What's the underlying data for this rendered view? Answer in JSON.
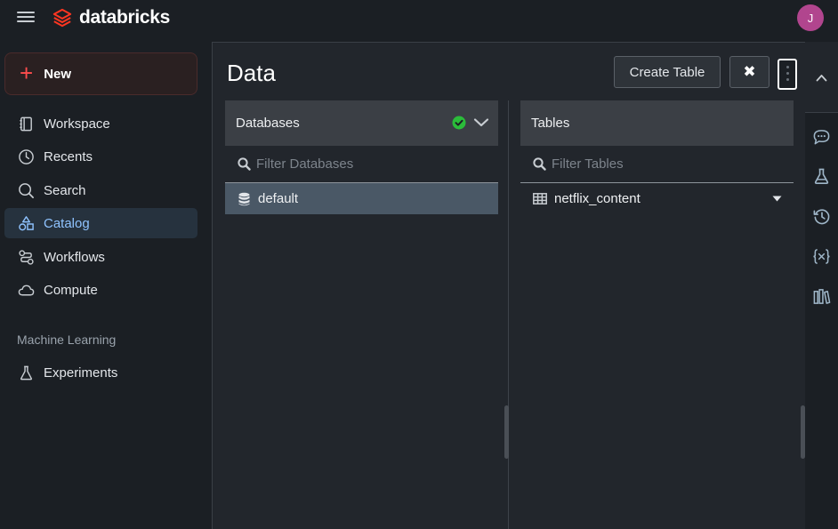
{
  "app": {
    "brand": "databricks",
    "avatar_initial": "J",
    "brand_color": "#ff3621",
    "accent_color": "#8fc3ff"
  },
  "sidebar": {
    "new_label": "New",
    "items": [
      {
        "label": "Workspace",
        "icon": "notebook-icon"
      },
      {
        "label": "Recents",
        "icon": "clock-icon"
      },
      {
        "label": "Search",
        "icon": "search-icon"
      },
      {
        "label": "Catalog",
        "icon": "catalog-icon",
        "active": true
      },
      {
        "label": "Workflows",
        "icon": "workflows-icon"
      },
      {
        "label": "Compute",
        "icon": "cloud-icon"
      }
    ],
    "section_label": "Machine Learning",
    "ml_items": [
      {
        "label": "Experiments",
        "icon": "flask-icon"
      }
    ]
  },
  "data_panel": {
    "title": "Data",
    "create_table_label": "Create Table",
    "close_label": "✖",
    "databases": {
      "header": "Databases",
      "filter_placeholder": "Filter Databases",
      "items": [
        "default"
      ],
      "selected": "default",
      "status_color": "#2bbc3a"
    },
    "tables": {
      "header": "Tables",
      "filter_placeholder": "Filter Tables",
      "items": [
        "netflix_content"
      ]
    }
  },
  "right_rail": {
    "icons": [
      "chevron-up-icon",
      "comment-icon",
      "flask-icon",
      "history-icon",
      "variables-icon",
      "library-icon"
    ]
  }
}
